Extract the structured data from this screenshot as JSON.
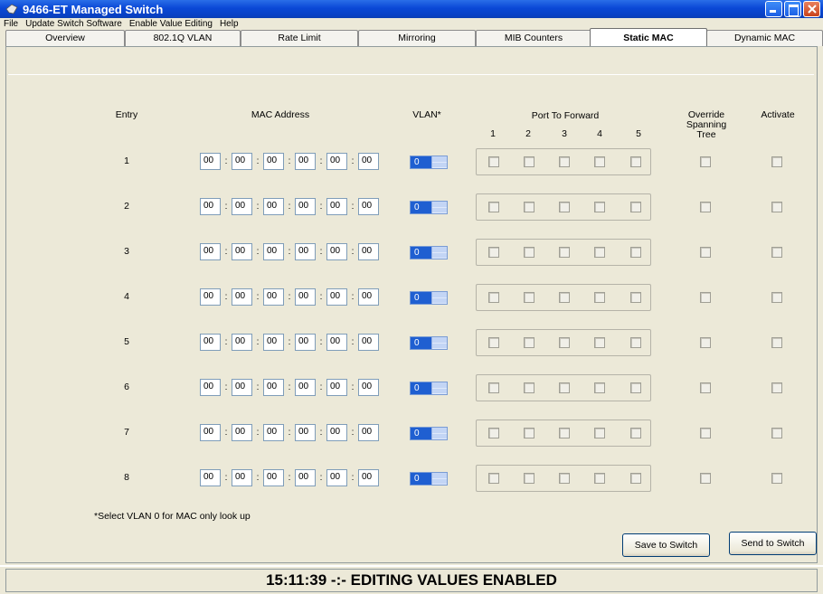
{
  "window": {
    "title": "9466-ET Managed Switch"
  },
  "menu": [
    "File",
    "Update Switch Software",
    "Enable Value Editing",
    "Help"
  ],
  "tabs": [
    "Overview",
    "802.1Q VLAN",
    "Rate Limit",
    "Mirroring",
    "MIB Counters",
    "Static MAC",
    "Dynamic MAC"
  ],
  "active_tab": "Static MAC",
  "headers": {
    "entry": "Entry",
    "mac": "MAC Address",
    "vlan": "VLAN*",
    "port_forward": "Port To Forward",
    "ports": [
      "1",
      "2",
      "3",
      "4",
      "5"
    ],
    "override": "Override Spanning Tree",
    "activate": "Activate"
  },
  "entries": [
    {
      "label": "1",
      "mac": [
        "00",
        "00",
        "00",
        "00",
        "00",
        "00"
      ],
      "vlan": "0"
    },
    {
      "label": "2",
      "mac": [
        "00",
        "00",
        "00",
        "00",
        "00",
        "00"
      ],
      "vlan": "0"
    },
    {
      "label": "3",
      "mac": [
        "00",
        "00",
        "00",
        "00",
        "00",
        "00"
      ],
      "vlan": "0"
    },
    {
      "label": "4",
      "mac": [
        "00",
        "00",
        "00",
        "00",
        "00",
        "00"
      ],
      "vlan": "0"
    },
    {
      "label": "5",
      "mac": [
        "00",
        "00",
        "00",
        "00",
        "00",
        "00"
      ],
      "vlan": "0"
    },
    {
      "label": "6",
      "mac": [
        "00",
        "00",
        "00",
        "00",
        "00",
        "00"
      ],
      "vlan": "0"
    },
    {
      "label": "7",
      "mac": [
        "00",
        "00",
        "00",
        "00",
        "00",
        "00"
      ],
      "vlan": "0"
    },
    {
      "label": "8",
      "mac": [
        "00",
        "00",
        "00",
        "00",
        "00",
        "00"
      ],
      "vlan": "0"
    }
  ],
  "note": "*Select VLAN 0 for MAC only look up",
  "buttons": {
    "save": "Save to Switch",
    "send": "Send to Switch"
  },
  "status": "15:11:39 -:- EDITING VALUES ENABLED",
  "colors": {
    "titlebar": "#0a48d6",
    "vlan_highlight": "#1f5fd1",
    "background": "#ece9d8"
  }
}
